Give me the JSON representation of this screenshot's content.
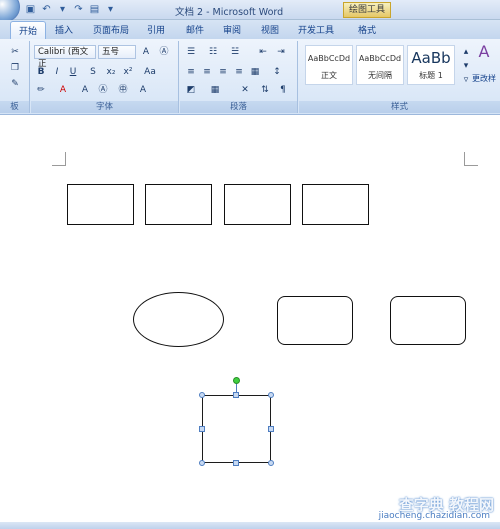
{
  "title_bar": {
    "title": "文档 2 - Microsoft Word",
    "context_tab": "绘图工具"
  },
  "tabs": [
    "开始",
    "插入",
    "页面布局",
    "引用",
    "邮件",
    "审阅",
    "视图",
    "开发工具",
    "格式"
  ],
  "font_group": {
    "font_name": "Calibri (西文正",
    "font_size": "五号",
    "label": "字体"
  },
  "paragraph_group": {
    "label": "段落"
  },
  "styles_group": {
    "label": "样式",
    "styles": [
      {
        "sample": "AaBbCcDd",
        "name": "正文"
      },
      {
        "sample": "AaBbCcDd",
        "name": "无间隔"
      },
      {
        "sample": "AaBb",
        "name": "标题 1"
      }
    ],
    "change_styles": "更改样"
  },
  "clipboard_group": {
    "label": "板"
  },
  "watermark": {
    "text": "查字典 教程网",
    "url": "jiaocheng.chazidian.com"
  }
}
